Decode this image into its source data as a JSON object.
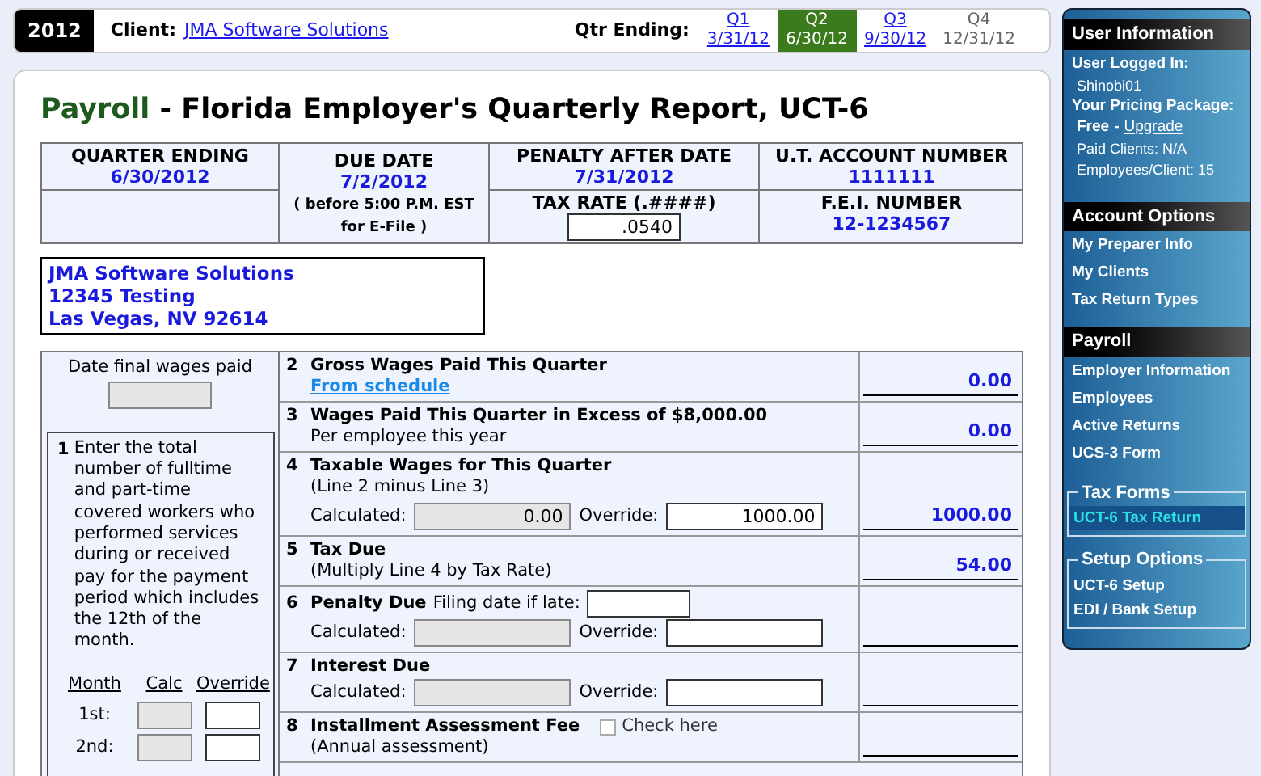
{
  "topbar": {
    "year": "2012",
    "client_label": "Client:",
    "client_name": "JMA Software Solutions",
    "qtr_label": "Qtr Ending:",
    "quarters": [
      {
        "name": "Q1",
        "date": "3/31/12",
        "selected": false,
        "disabled": false
      },
      {
        "name": "Q2",
        "date": "6/30/12",
        "selected": true,
        "disabled": false
      },
      {
        "name": "Q3",
        "date": "9/30/12",
        "selected": false,
        "disabled": false
      },
      {
        "name": "Q4",
        "date": "12/31/12",
        "selected": false,
        "disabled": true
      }
    ]
  },
  "title": {
    "prefix": "Payroll",
    "rest": " - Florida Employer's Quarterly Report, UCT-6"
  },
  "header": {
    "quarter_ending": {
      "label": "QUARTER ENDING",
      "value": "6/30/2012"
    },
    "due_date": {
      "label": "DUE DATE",
      "value": "7/2/2012",
      "note": "( before 5:00 P.M. EST for E-File )"
    },
    "penalty_date": {
      "label": "PENALTY AFTER DATE",
      "value": "7/31/2012"
    },
    "account_number": {
      "label": "U.T. ACCOUNT NUMBER",
      "value": "1111111"
    },
    "tax_rate": {
      "label": "TAX RATE (.####)",
      "value": ".0540"
    },
    "fei_number": {
      "label": "F.E.I. NUMBER",
      "value": "12-1234567"
    }
  },
  "address": [
    "JMA Software Solutions",
    "12345 Testing",
    "Las Vegas, NV 92614"
  ],
  "left": {
    "date_final_label": "Date final wages paid",
    "line1_number": "1",
    "line1_text": "Enter the total number of fulltime and part-time covered workers who performed services during or received pay for the payment period which includes the 12th of the month.",
    "columns": [
      "Month",
      "Calc",
      "Override"
    ],
    "months": [
      {
        "label": "1st:"
      },
      {
        "label": "2nd:"
      }
    ]
  },
  "lines": [
    {
      "number": "2",
      "title": "Gross Wages Paid This Quarter",
      "link": "From schedule",
      "amount": "0.00"
    },
    {
      "number": "3",
      "title": "Wages Paid This Quarter in Excess of $8,000.00",
      "note": "Per employee this year",
      "amount": "0.00"
    },
    {
      "number": "4",
      "title": "Taxable Wages for This Quarter",
      "note": "(Line 2 minus Line 3)",
      "calc_label": "Calculated:",
      "calc_value": "0.00",
      "override_label": "Override:",
      "override_value": "1000.00",
      "amount": "1000.00"
    },
    {
      "number": "5",
      "title": "Tax Due",
      "note": "(Multiply Line 4 by Tax Rate)",
      "amount": "54.00"
    },
    {
      "number": "6",
      "title": "Penalty Due",
      "inline_label": "Filing date if late:",
      "calc_label": "Calculated:",
      "override_label": "Override:"
    },
    {
      "number": "7",
      "title": "Interest Due",
      "calc_label": "Calculated:",
      "override_label": "Override:"
    },
    {
      "number": "8",
      "title": "Installment Assessment Fee",
      "checkbox_label": "Check here",
      "checked": false,
      "note": "(Annual assessment)"
    }
  ],
  "sidebar": {
    "user": {
      "title": "User Information",
      "logged_label": "User Logged In:",
      "username": "Shinobi01",
      "package_label": "Your Pricing Package:",
      "package": "Free",
      "separator": "-",
      "upgrade": "Upgrade",
      "paid_clients": "Paid Clients: N/A",
      "employees": "Employees/Client: 15"
    },
    "sections": [
      {
        "title": "Account Options",
        "items": [
          {
            "label": "My Preparer Info",
            "selected": false
          },
          {
            "label": "My Clients",
            "selected": false
          },
          {
            "label": "Tax Return Types",
            "selected": false
          }
        ]
      },
      {
        "title": "Payroll",
        "items": [
          {
            "label": "Employer Information",
            "selected": false
          },
          {
            "label": "Employees",
            "selected": false
          },
          {
            "label": "Active Returns",
            "selected": false
          },
          {
            "label": "UCS-3 Form",
            "selected": false
          }
        ]
      }
    ],
    "groups": [
      {
        "title": "Tax Forms",
        "items": [
          {
            "label": "UCT-6 Tax Return",
            "selected": true
          }
        ]
      },
      {
        "title": "Setup Options",
        "items": [
          {
            "label": "UCT-6 Setup",
            "selected": false
          },
          {
            "label": "EDI / Bank Setup",
            "selected": false
          }
        ]
      }
    ]
  }
}
